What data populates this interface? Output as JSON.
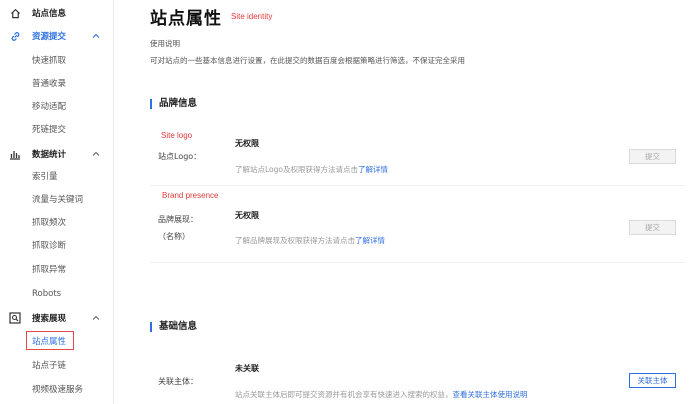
{
  "sidebar": {
    "items": [
      {
        "label": "站点信息",
        "type": "group",
        "icon": "home-icon"
      },
      {
        "label": "资源提交",
        "type": "group",
        "icon": "link-icon",
        "active": true
      },
      {
        "label": "快速抓取",
        "type": "sub"
      },
      {
        "label": "普通收录",
        "type": "sub"
      },
      {
        "label": "移动适配",
        "type": "sub"
      },
      {
        "label": "死链提交",
        "type": "sub"
      },
      {
        "label": "数据统计",
        "type": "group",
        "icon": "bar-chart-icon"
      },
      {
        "label": "索引量",
        "type": "sub"
      },
      {
        "label": "流量与关键词",
        "type": "sub"
      },
      {
        "label": "抓取频次",
        "type": "sub"
      },
      {
        "label": "抓取诊断",
        "type": "sub"
      },
      {
        "label": "抓取异常",
        "type": "sub"
      },
      {
        "label": "Robots",
        "type": "sub"
      },
      {
        "label": "搜索展现",
        "type": "group",
        "icon": "search-display-icon"
      },
      {
        "label": "站点属性",
        "type": "sub",
        "selected": true
      },
      {
        "label": "站点子链",
        "type": "sub"
      },
      {
        "label": "视频极速服务",
        "type": "sub"
      }
    ]
  },
  "page": {
    "title": "站点属性",
    "title_annotation": "Site identity",
    "desc_head": "使用说明",
    "desc_body": "可对站点的一些基本信息进行设置，在此提交的数据百度会根据策略进行筛选，不保证完全采用"
  },
  "brand_section": {
    "title": "品牌信息",
    "logo": {
      "annotation": "Site logo",
      "label": "站点Logo：",
      "status": "无权限",
      "hint": "了解站点Logo及权限获得方法请点击",
      "link": "了解详情",
      "button": "提交"
    },
    "presence": {
      "annotation": "Brand presence",
      "label": "品牌展现：",
      "label_sub": "（名称）",
      "status": "无权限",
      "hint": "了解品牌展现及权限获得方法请点击",
      "link": "了解详情",
      "button": "提交"
    }
  },
  "basic_section": {
    "title": "基础信息",
    "entity": {
      "label": "关联主体：",
      "status": "未关联",
      "hint": "站点关联主体后即可提交资源并有机会享有快速进入搜索的权益，",
      "link": "查看关联主体使用说明",
      "button": "关联主体"
    }
  },
  "colors": {
    "accent": "#2f6fe0",
    "annotation": "#e23b3b"
  }
}
